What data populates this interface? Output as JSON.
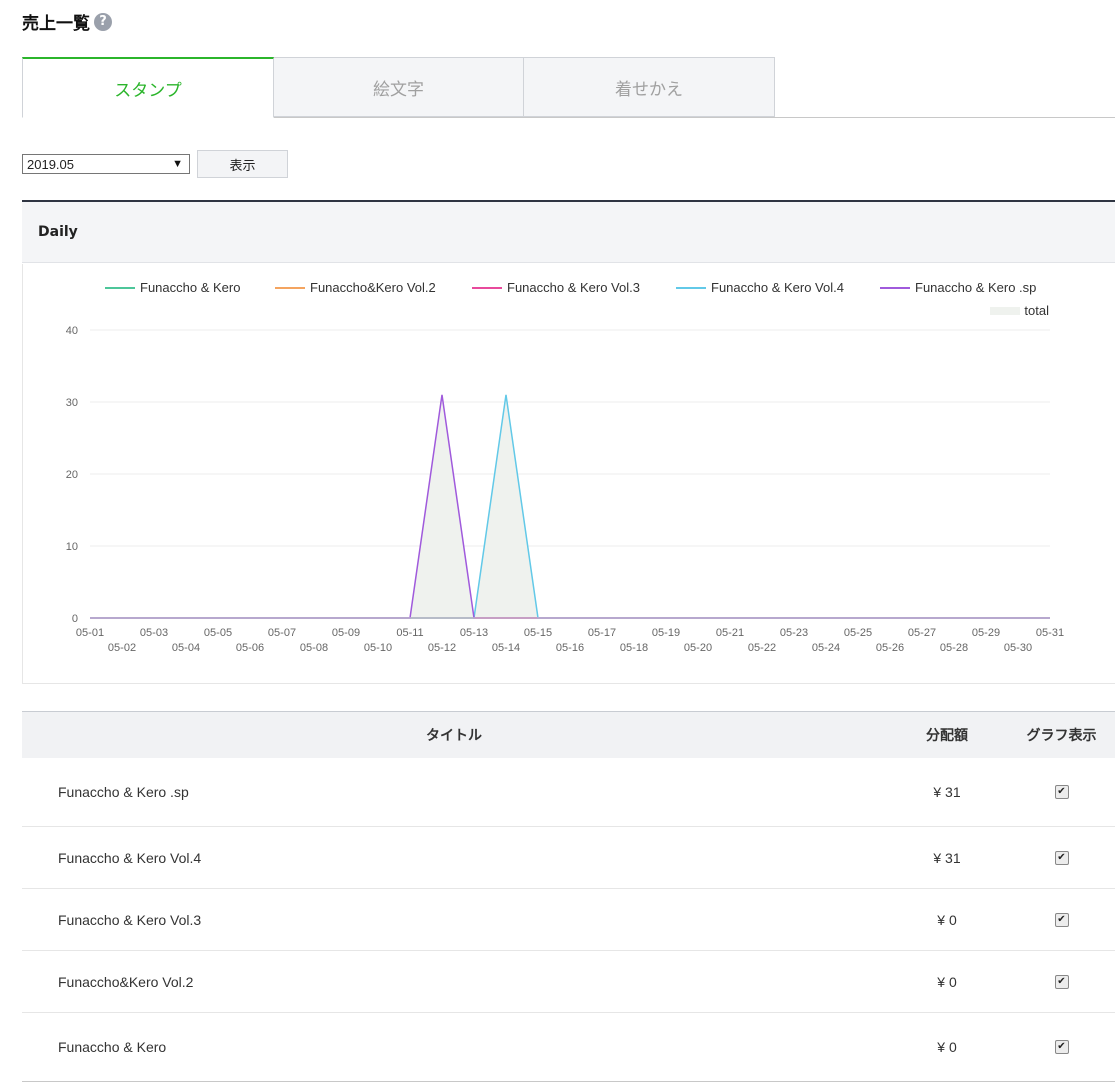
{
  "page": {
    "title": "売上一覧",
    "help_icon": "question-circle-icon"
  },
  "tabs": [
    {
      "label": "スタンプ",
      "active": true
    },
    {
      "label": "絵文字",
      "active": false
    },
    {
      "label": "着せかえ",
      "active": false
    }
  ],
  "filter": {
    "month": "2019.05",
    "show_button": "表示"
  },
  "daily": {
    "header": "Daily"
  },
  "chart_data": {
    "type": "line",
    "x": [
      "05-01",
      "05-02",
      "05-03",
      "05-04",
      "05-05",
      "05-06",
      "05-07",
      "05-08",
      "05-09",
      "05-10",
      "05-11",
      "05-12",
      "05-13",
      "05-14",
      "05-15",
      "05-16",
      "05-17",
      "05-18",
      "05-19",
      "05-20",
      "05-21",
      "05-22",
      "05-23",
      "05-24",
      "05-25",
      "05-26",
      "05-27",
      "05-28",
      "05-29",
      "05-30",
      "05-31"
    ],
    "ylim": [
      0,
      40
    ],
    "yticks": [
      0,
      10,
      20,
      30,
      40
    ],
    "grid": true,
    "legend_position": "top-right",
    "series": [
      {
        "name": "Funaccho & Kero",
        "color": "#4dc69a",
        "values": [
          0,
          0,
          0,
          0,
          0,
          0,
          0,
          0,
          0,
          0,
          0,
          0,
          0,
          0,
          0,
          0,
          0,
          0,
          0,
          0,
          0,
          0,
          0,
          0,
          0,
          0,
          0,
          0,
          0,
          0,
          0
        ]
      },
      {
        "name": "Funaccho&Kero Vol.2",
        "color": "#f4a460",
        "values": [
          0,
          0,
          0,
          0,
          0,
          0,
          0,
          0,
          0,
          0,
          0,
          0,
          0,
          0,
          0,
          0,
          0,
          0,
          0,
          0,
          0,
          0,
          0,
          0,
          0,
          0,
          0,
          0,
          0,
          0,
          0
        ]
      },
      {
        "name": "Funaccho & Kero Vol.3",
        "color": "#e84a9c",
        "values": [
          0,
          0,
          0,
          0,
          0,
          0,
          0,
          0,
          0,
          0,
          0,
          0,
          0,
          0,
          0,
          0,
          0,
          0,
          0,
          0,
          0,
          0,
          0,
          0,
          0,
          0,
          0,
          0,
          0,
          0,
          0
        ]
      },
      {
        "name": "Funaccho & Kero Vol.4",
        "color": "#62c9e8",
        "values": [
          0,
          0,
          0,
          0,
          0,
          0,
          0,
          0,
          0,
          0,
          0,
          0,
          0,
          31,
          0,
          0,
          0,
          0,
          0,
          0,
          0,
          0,
          0,
          0,
          0,
          0,
          0,
          0,
          0,
          0,
          0
        ]
      },
      {
        "name": "Funaccho & Kero .sp",
        "color": "#a05adc",
        "values": [
          0,
          0,
          0,
          0,
          0,
          0,
          0,
          0,
          0,
          0,
          0,
          31,
          0,
          0,
          0,
          0,
          0,
          0,
          0,
          0,
          0,
          0,
          0,
          0,
          0,
          0,
          0,
          0,
          0,
          0,
          0
        ]
      },
      {
        "name": "total",
        "color": "#eff2ee",
        "type": "area",
        "values": [
          0,
          0,
          0,
          0,
          0,
          0,
          0,
          0,
          0,
          0,
          0,
          31,
          0,
          31,
          0,
          0,
          0,
          0,
          0,
          0,
          0,
          0,
          0,
          0,
          0,
          0,
          0,
          0,
          0,
          0,
          0
        ]
      }
    ]
  },
  "table": {
    "headers": {
      "title": "タイトル",
      "amount": "分配額",
      "graph": "グラフ表示"
    },
    "rows": [
      {
        "title": "Funaccho & Kero .sp",
        "amount": "¥ 31",
        "graph": true
      },
      {
        "title": "Funaccho & Kero Vol.4",
        "amount": "¥ 31",
        "graph": true
      },
      {
        "title": "Funaccho & Kero Vol.3",
        "amount": "¥ 0",
        "graph": true
      },
      {
        "title": "Funaccho&Kero Vol.2",
        "amount": "¥ 0",
        "graph": true
      },
      {
        "title": "Funaccho & Kero",
        "amount": "¥ 0",
        "graph": true
      }
    ]
  }
}
